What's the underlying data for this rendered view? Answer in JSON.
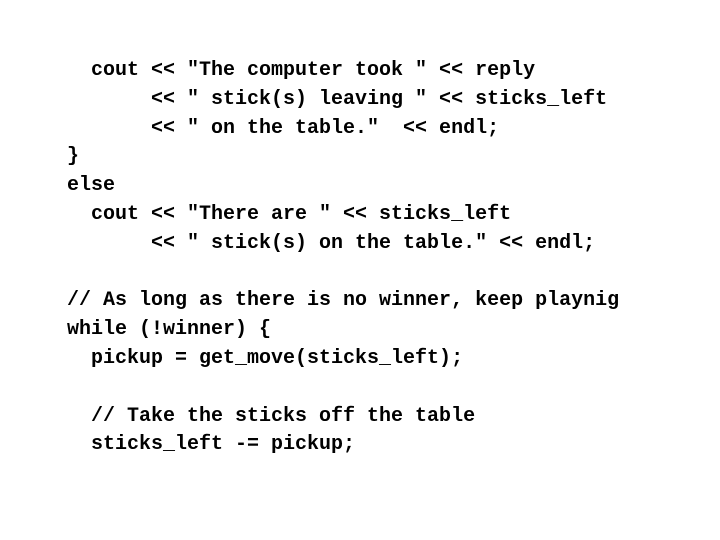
{
  "document": {
    "type": "code-slide",
    "language": "C++",
    "lines": [
      "  cout << \"The computer took \" << reply",
      "       << \" stick(s) leaving \" << sticks_left",
      "       << \" on the table.\"  << endl;",
      "}",
      "else",
      "  cout << \"There are \" << sticks_left",
      "       << \" stick(s) on the table.\" << endl;",
      "",
      "// As long as there is no winner, keep playnig",
      "while (!winner) {",
      "  pickup = get_move(sticks_left);",
      "",
      "  // Take the sticks off the table",
      "  sticks_left -= pickup;"
    ]
  }
}
